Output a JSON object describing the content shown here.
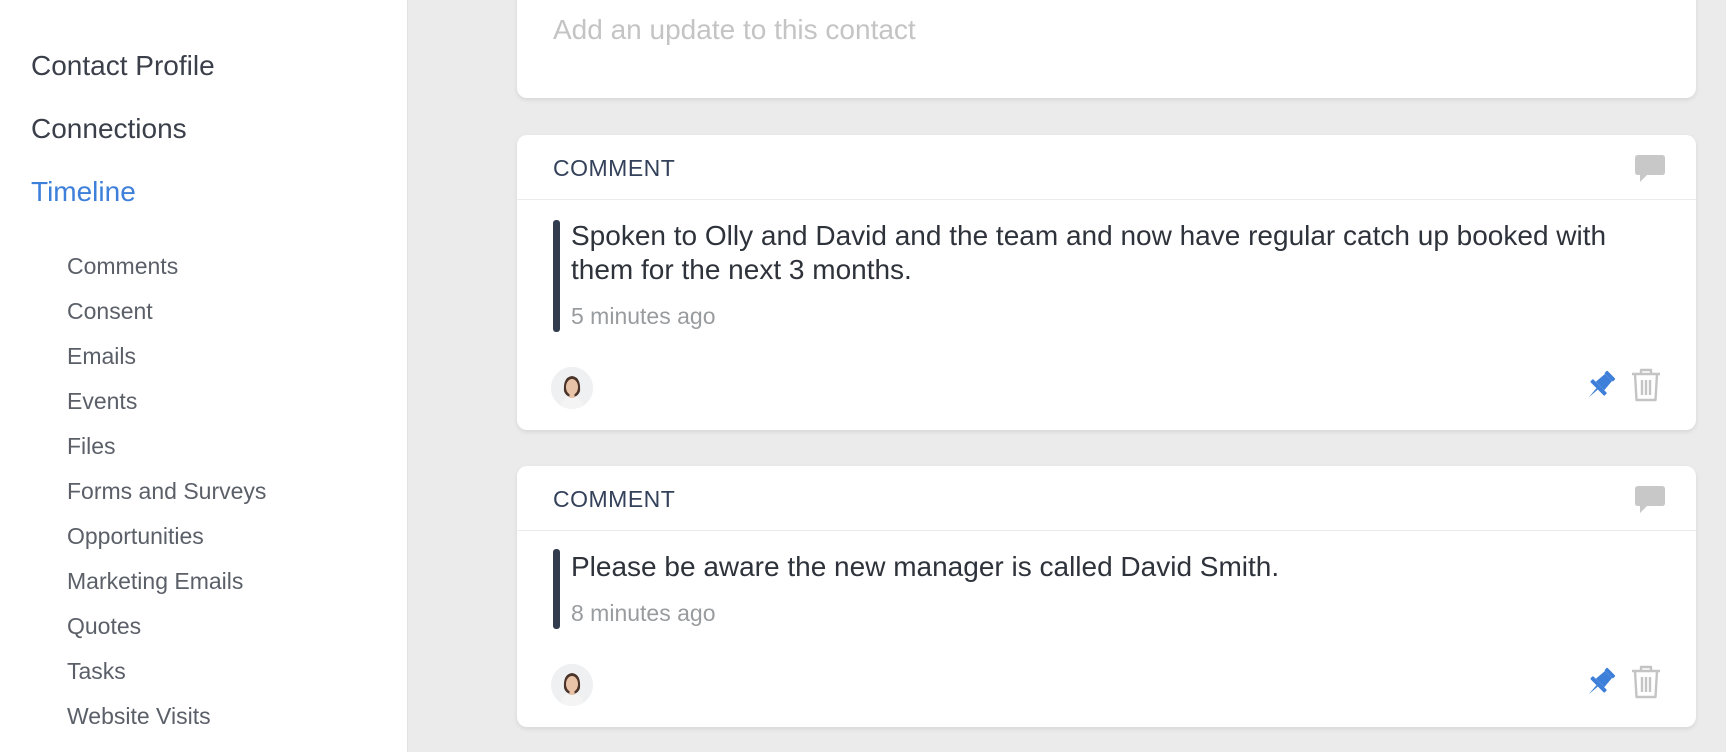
{
  "sidebar": {
    "main_items": [
      {
        "label": "Contact Profile"
      },
      {
        "label": "Connections"
      },
      {
        "label": "Timeline"
      }
    ],
    "timeline_items": [
      {
        "label": "Comments"
      },
      {
        "label": "Consent"
      },
      {
        "label": "Emails"
      },
      {
        "label": "Events"
      },
      {
        "label": "Files"
      },
      {
        "label": "Forms and Surveys"
      },
      {
        "label": "Opportunities"
      },
      {
        "label": "Marketing Emails"
      },
      {
        "label": "Quotes"
      },
      {
        "label": "Tasks"
      },
      {
        "label": "Website Visits"
      }
    ],
    "active_item": "Timeline"
  },
  "update_box": {
    "placeholder": "Add an update to this contact",
    "value": ""
  },
  "timeline": [
    {
      "type": "COMMENT",
      "text": "Spoken to Olly and David and the team and now have regular catch up booked with them for the next 3 months.",
      "time": "5 minutes ago",
      "icons": [
        "comment-icon",
        "avatar",
        "pin-icon",
        "trash-icon"
      ]
    },
    {
      "type": "COMMENT",
      "text": "Please be aware the new manager is called David Smith.",
      "time": "8 minutes ago",
      "icons": [
        "comment-icon",
        "avatar",
        "pin-icon",
        "trash-icon"
      ]
    }
  ],
  "colors": {
    "accent": "#3d7fd9",
    "pin": "#3d7fd9",
    "text_dark": "#2e323a",
    "muted": "#999c9f",
    "background": "#ebebeb",
    "bar": "#333c4f"
  }
}
